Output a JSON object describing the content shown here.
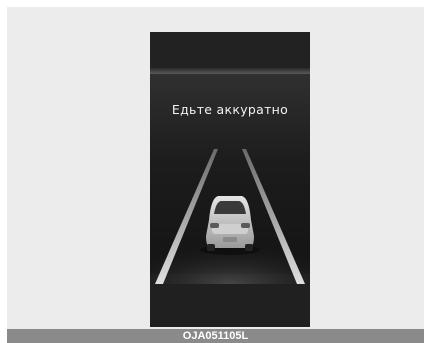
{
  "screen": {
    "message": "Едьте аккуратно",
    "icon": "car-front-icon"
  },
  "footer": {
    "code": "OJA051105L"
  },
  "colors": {
    "panel_background": "#ececec",
    "screen_background": "#1a1a1a",
    "lane_line": "#d9d9d9",
    "footer_bar": "#8a8a8a"
  }
}
